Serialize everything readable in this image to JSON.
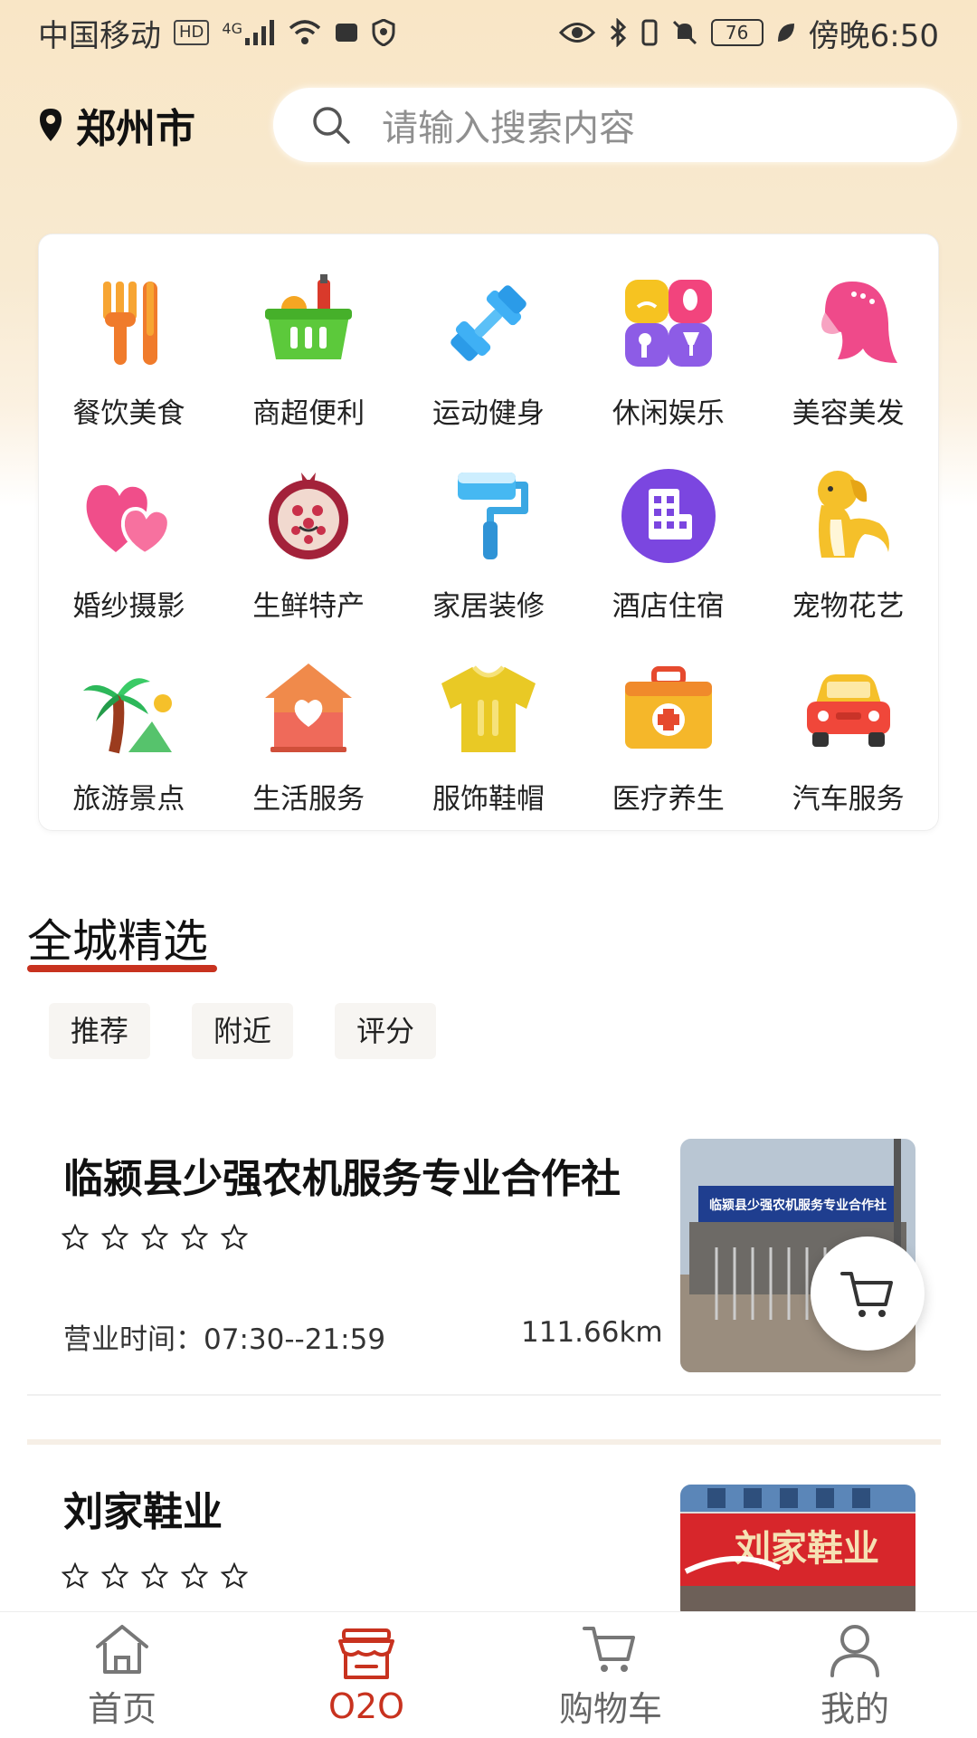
{
  "status_bar": {
    "carrier": "中国移动",
    "hd": "HD",
    "network": "4G",
    "battery": "76",
    "time": "傍晚6:50"
  },
  "header": {
    "city": "郑州市",
    "search_placeholder": "请输入搜索内容"
  },
  "categories": [
    {
      "label": "餐饮美食",
      "icon": "fork-knife-icon"
    },
    {
      "label": "商超便利",
      "icon": "grocery-basket-icon"
    },
    {
      "label": "运动健身",
      "icon": "dumbbell-icon"
    },
    {
      "label": "休闲娱乐",
      "icon": "leisure-icon"
    },
    {
      "label": "美容美发",
      "icon": "beauty-hair-icon"
    },
    {
      "label": "婚纱摄影",
      "icon": "hearts-icon"
    },
    {
      "label": "生鲜特产",
      "icon": "pomegranate-icon"
    },
    {
      "label": "家居装修",
      "icon": "paint-roller-icon"
    },
    {
      "label": "酒店住宿",
      "icon": "hotel-icon"
    },
    {
      "label": "宠物花艺",
      "icon": "dog-icon"
    },
    {
      "label": "旅游景点",
      "icon": "palm-tree-icon"
    },
    {
      "label": "生活服务",
      "icon": "house-heart-icon"
    },
    {
      "label": "服饰鞋帽",
      "icon": "shirt-icon"
    },
    {
      "label": "医疗养生",
      "icon": "medical-kit-icon"
    },
    {
      "label": "汽车服务",
      "icon": "car-icon"
    }
  ],
  "section": {
    "title": "全城精选",
    "filters": [
      "推荐",
      "附近",
      "评分"
    ]
  },
  "stores": [
    {
      "name": "临颍县少强农机服务专业合作社",
      "rating": 0,
      "hours": "营业时间：07:30--21:59",
      "distance": "111.66km",
      "sign_text": "临颍县少强农机服务专业合作社"
    },
    {
      "name": "刘家鞋业",
      "rating": 0,
      "sign_text": "刘家鞋业"
    }
  ],
  "bottom_nav": [
    {
      "label": "首页",
      "icon": "home-icon",
      "active": false
    },
    {
      "label": "O2O",
      "icon": "store-icon",
      "active": true
    },
    {
      "label": "购物车",
      "icon": "cart-icon",
      "active": false
    },
    {
      "label": "我的",
      "icon": "user-icon",
      "active": false
    }
  ],
  "colors": {
    "accent": "#c8321f",
    "header_bg": "#f9e6c6",
    "text": "#222222"
  }
}
